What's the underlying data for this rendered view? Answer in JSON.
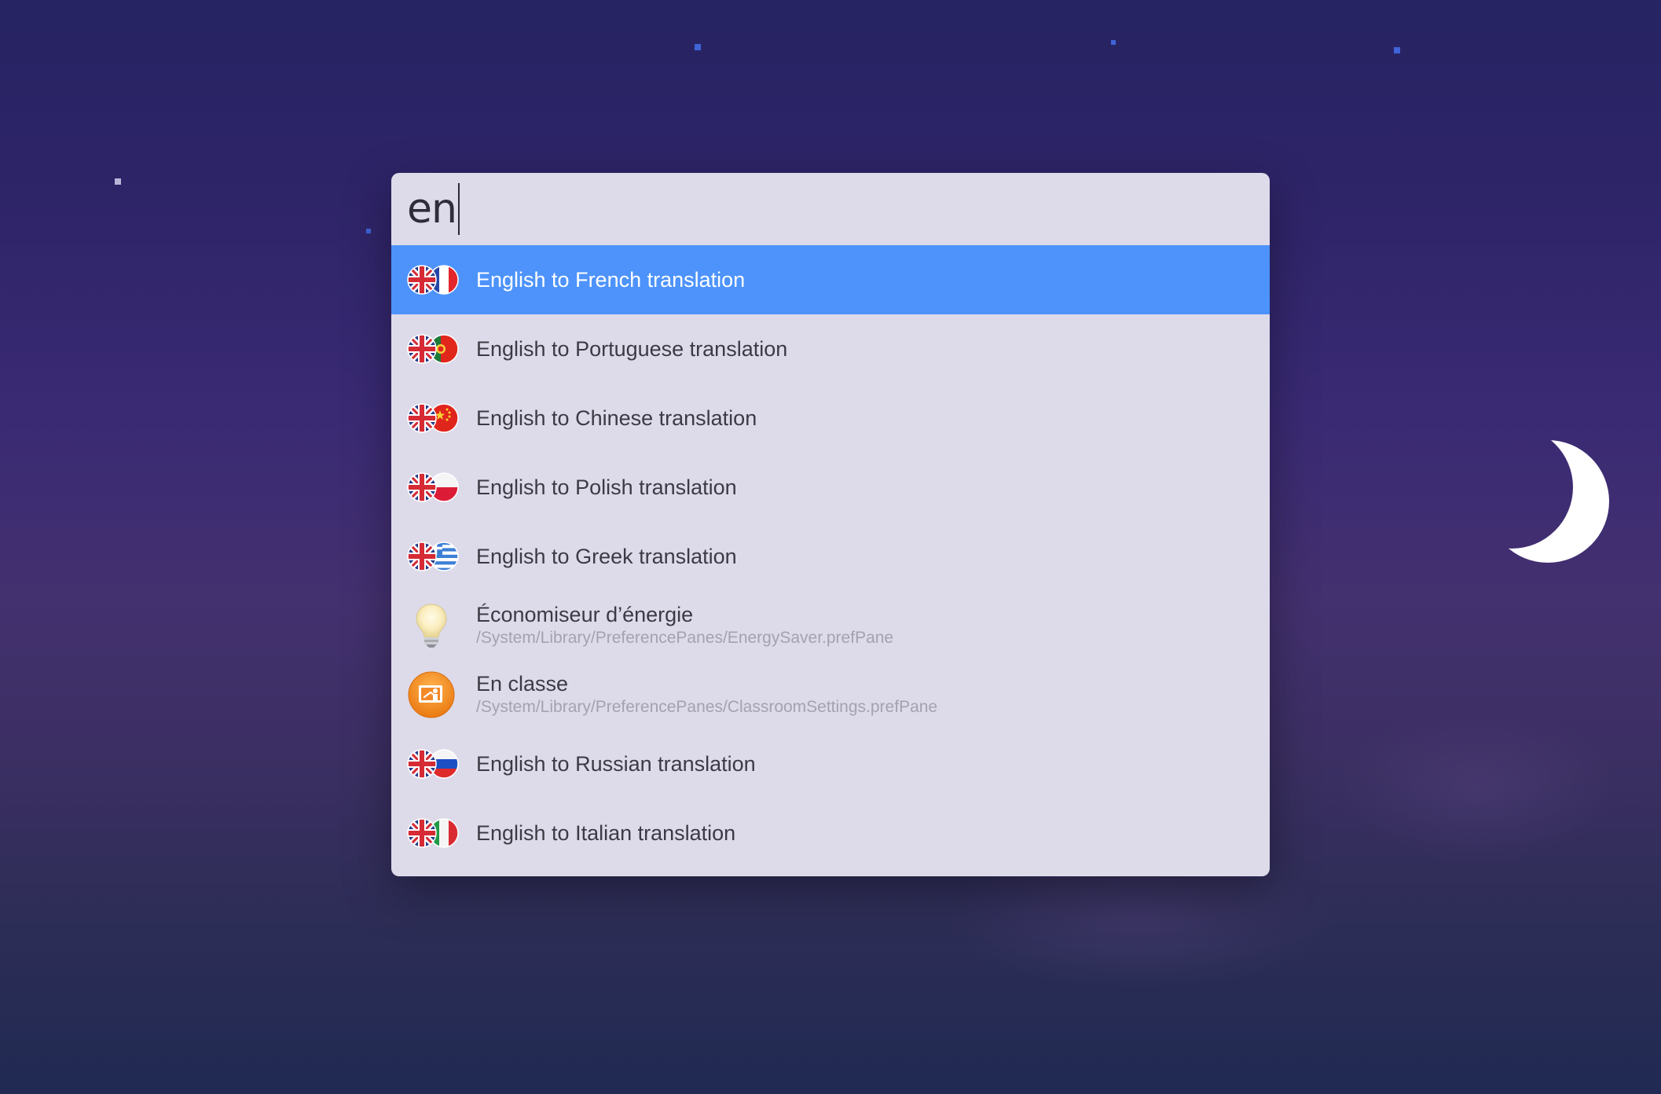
{
  "search": {
    "query": "en"
  },
  "results": [
    {
      "label": "English to French translation",
      "icon": "uk-france-flags-icon",
      "selected": true
    },
    {
      "label": "English to Portuguese translation",
      "icon": "uk-portugal-flags-icon"
    },
    {
      "label": "English to Chinese translation",
      "icon": "uk-china-flags-icon"
    },
    {
      "label": "English to Polish translation",
      "icon": "uk-poland-flags-icon"
    },
    {
      "label": "English to Greek translation",
      "icon": "uk-greece-flags-icon"
    },
    {
      "label": "Économiseur d’énergie",
      "subtitle": "/System/Library/PreferencePanes/EnergySaver.prefPane",
      "icon": "lightbulb-icon"
    },
    {
      "label": "En classe",
      "subtitle": "/System/Library/PreferencePanes/ClassroomSettings.prefPane",
      "icon": "classroom-icon"
    },
    {
      "label": "English to Russian translation",
      "icon": "uk-russia-flags-icon"
    },
    {
      "label": "English to Italian translation",
      "icon": "uk-italy-flags-icon"
    }
  ],
  "colors": {
    "selection": "#4d93fb",
    "panel": "#dddbe9",
    "text": "#3b3a45",
    "subtext": "#a3a2b1"
  }
}
